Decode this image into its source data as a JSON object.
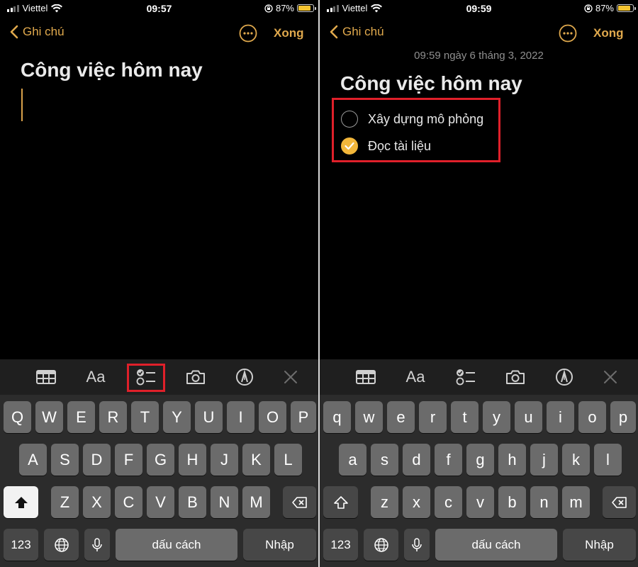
{
  "status_bar": {
    "carrier": "Viettel",
    "battery": "87%",
    "battery_level": 0.87
  },
  "left": {
    "time": "09:57",
    "nav": {
      "back_label": "Ghi chú",
      "done_label": "Xong"
    },
    "note_title": "Công việc hôm nay",
    "keys": {
      "row1": [
        "Q",
        "W",
        "E",
        "R",
        "T",
        "Y",
        "U",
        "I",
        "O",
        "P"
      ],
      "row2": [
        "A",
        "S",
        "D",
        "F",
        "G",
        "H",
        "J",
        "K",
        "L"
      ],
      "row3": [
        "Z",
        "X",
        "C",
        "V",
        "B",
        "N",
        "M"
      ],
      "num": "123",
      "space": "dấu cách",
      "return": "Nhập"
    }
  },
  "right": {
    "time": "09:59",
    "nav": {
      "back_label": "Ghi chú",
      "done_label": "Xong"
    },
    "date_line": "09:59 ngày 6 tháng 3, 2022",
    "note_title": "Công việc hôm nay",
    "checklist": [
      {
        "text": "Xây dựng mô phỏng",
        "checked": false
      },
      {
        "text": "Đọc tài liệu",
        "checked": true
      }
    ],
    "keys": {
      "row1": [
        "q",
        "w",
        "e",
        "r",
        "t",
        "y",
        "u",
        "i",
        "o",
        "p"
      ],
      "row2": [
        "a",
        "s",
        "d",
        "f",
        "g",
        "h",
        "j",
        "k",
        "l"
      ],
      "row3": [
        "z",
        "x",
        "c",
        "v",
        "b",
        "n",
        "m"
      ],
      "num": "123",
      "space": "dấu cách",
      "return": "Nhập"
    }
  },
  "toolbar": {
    "format_label": "Aa",
    "icons": [
      "table-icon",
      "format-icon",
      "checklist-icon",
      "camera-icon",
      "markup-icon",
      "close-icon"
    ]
  },
  "colors": {
    "accent": "#e0a94d",
    "highlight": "#e0202a",
    "check_fill": "#f3b73a"
  }
}
